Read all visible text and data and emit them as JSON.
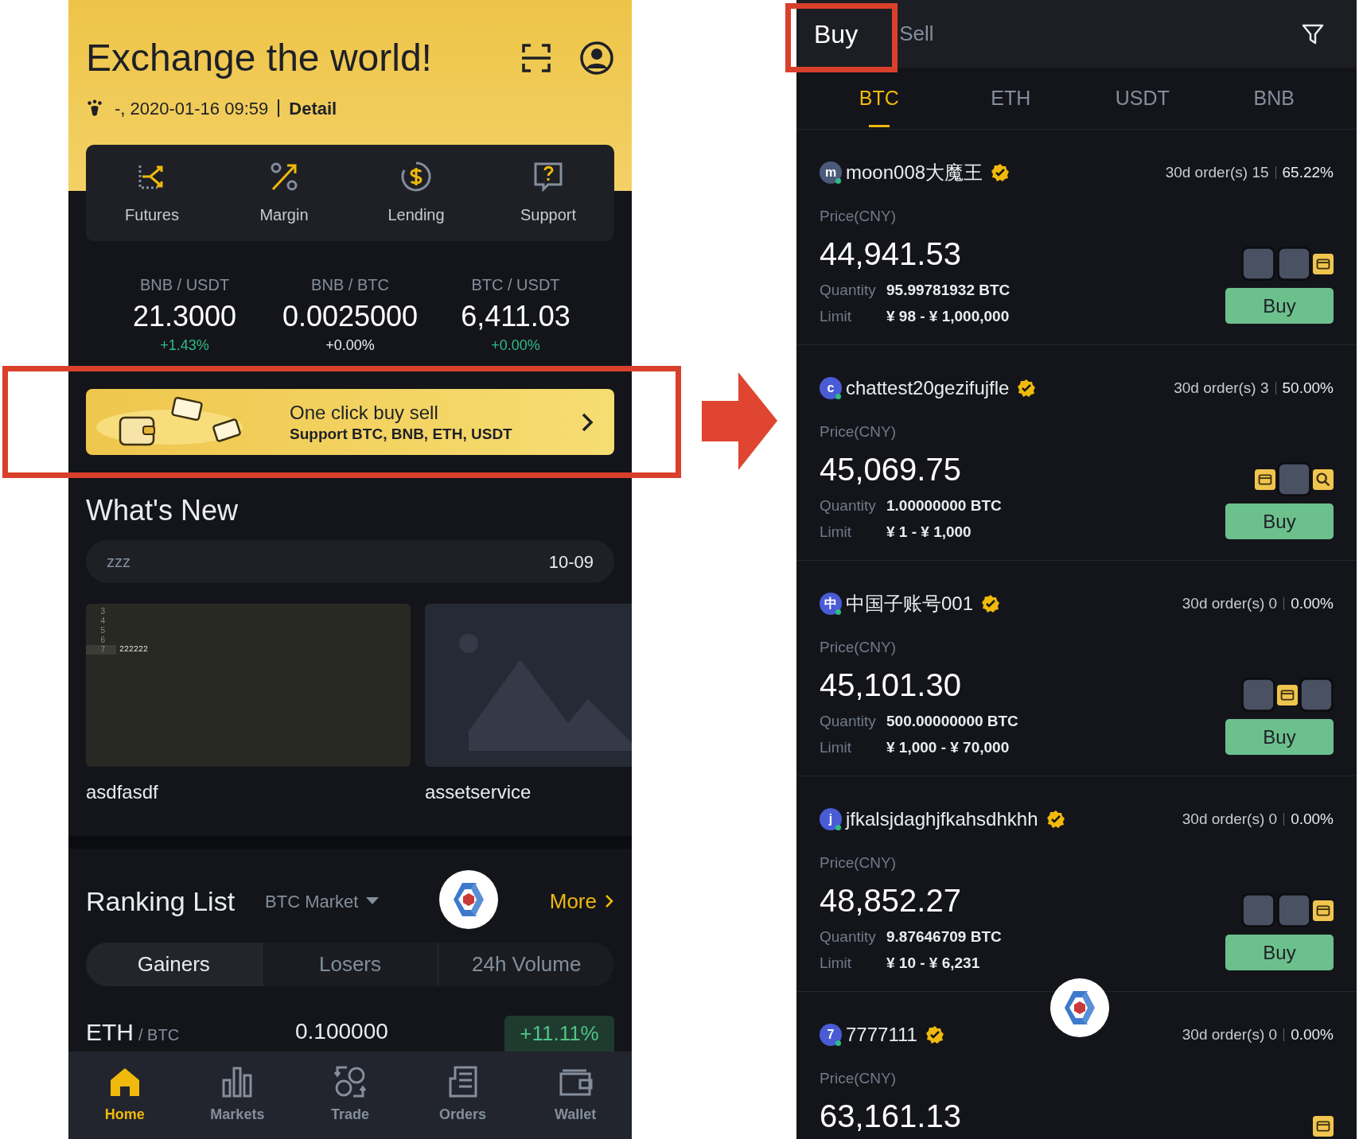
{
  "home_screen": {
    "header": {
      "title": "Exchange the world!",
      "login_info": "-, 2020-01-16 09:59",
      "detail_link": "Detail"
    },
    "quick_menu": [
      {
        "kind": "futures",
        "label": "Futures"
      },
      {
        "kind": "margin",
        "label": "Margin"
      },
      {
        "kind": "lending",
        "label": "Lending"
      },
      {
        "kind": "support",
        "label": "Support"
      }
    ],
    "tickers": [
      {
        "pair": "BNB / USDT",
        "price": "21.3000",
        "change": "+1.43%",
        "color": "#2ebd85"
      },
      {
        "pair": "BNB / BTC",
        "price": "0.0025000",
        "change": "+0.00%",
        "color": "#eaecef"
      },
      {
        "pair": "BTC / USDT",
        "price": "6,411.03",
        "change": "+0.00%",
        "color": "#2ebd85"
      }
    ],
    "promo_banner": {
      "title": "One click buy sell",
      "subtitle": "Support BTC, BNB, ETH, USDT"
    },
    "whats_new": {
      "title": "What's New",
      "notice": {
        "text": "zzz",
        "date": "10-09"
      },
      "cards": [
        {
          "kind": "editor",
          "line_numbers": [
            "3",
            "4",
            "5",
            "6",
            "7"
          ],
          "editor_text": "222222",
          "caption": "asdfasdf"
        },
        {
          "kind": "placeholder",
          "caption": "assetservice"
        }
      ]
    },
    "ranking": {
      "title": "Ranking List",
      "market": "BTC Market",
      "more": "More",
      "tabs": [
        {
          "label": "Gainers",
          "selected": true
        },
        {
          "label": "Losers",
          "selected": false
        },
        {
          "label": "24h Volume",
          "selected": false
        }
      ],
      "rows": [
        {
          "base": "ETH",
          "quote": "/ BTC",
          "price": "0.100000",
          "change": "+11.11%"
        }
      ]
    },
    "bottom_nav": [
      {
        "kind": "home",
        "label": "Home",
        "selected": true
      },
      {
        "kind": "markets",
        "label": "Markets",
        "selected": false
      },
      {
        "kind": "trade",
        "label": "Trade",
        "selected": false
      },
      {
        "kind": "orders",
        "label": "Orders",
        "selected": false
      },
      {
        "kind": "wallet",
        "label": "Wallet",
        "selected": false
      }
    ]
  },
  "p2p_screen": {
    "side_tabs": [
      {
        "label": "Buy",
        "selected": true
      },
      {
        "label": "Sell",
        "selected": false
      }
    ],
    "coin_tabs": [
      {
        "label": "BTC",
        "selected": true
      },
      {
        "label": "ETH",
        "selected": false
      },
      {
        "label": "USDT",
        "selected": false
      },
      {
        "label": "BNB",
        "selected": false
      }
    ],
    "listings": [
      {
        "avatar": "m",
        "color": "#4b5a7a",
        "online": true,
        "name": "moon008大魔王",
        "verified": true,
        "orders": "30d order(s) 15",
        "completion": "65.22%",
        "price_label": "Price(CNY)",
        "price": "44,941.53",
        "quantity_label": "Quantity",
        "quantity": "95.99781932 BTC",
        "limit_label": "Limit",
        "limit": "¥ 98 - ¥ 1,000,000",
        "payment_icons": [
          {
            "kind": "tile"
          },
          {
            "kind": "tile"
          },
          {
            "kind": "card"
          }
        ],
        "button": "Buy"
      },
      {
        "avatar": "c",
        "color": "#4a5bd6",
        "online": true,
        "name": "chattest20gezifujfle",
        "verified": true,
        "orders": "30d order(s) 3",
        "completion": "50.00%",
        "price_label": "Price(CNY)",
        "price": "45,069.75",
        "quantity_label": "Quantity",
        "quantity": "1.00000000 BTC",
        "limit_label": "Limit",
        "limit": "¥ 1 - ¥ 1,000",
        "payment_icons": [
          {
            "kind": "card"
          },
          {
            "kind": "tile"
          },
          {
            "kind": "search"
          }
        ],
        "button": "Buy"
      },
      {
        "avatar": "中",
        "color": "#4a5bd6",
        "online": true,
        "name": "中国子账号001",
        "verified": true,
        "orders": "30d order(s) 0",
        "completion": "0.00%",
        "price_label": "Price(CNY)",
        "price": "45,101.30",
        "quantity_label": "Quantity",
        "quantity": "500.00000000 BTC",
        "limit_label": "Limit",
        "limit": "¥ 1,000 - ¥ 70,000",
        "payment_icons": [
          {
            "kind": "tile"
          },
          {
            "kind": "card"
          },
          {
            "kind": "tile"
          }
        ],
        "button": "Buy"
      },
      {
        "avatar": "j",
        "color": "#4a5bd6",
        "online": true,
        "name": "jfkalsjdaghjfkahsdhkhh",
        "verified": true,
        "orders": "30d order(s) 0",
        "completion": "0.00%",
        "price_label": "Price(CNY)",
        "price": "48,852.27",
        "quantity_label": "Quantity",
        "quantity": "9.87646709 BTC",
        "limit_label": "Limit",
        "limit": "¥ 10 - ¥ 6,231",
        "payment_icons": [
          {
            "kind": "tile"
          },
          {
            "kind": "tile"
          },
          {
            "kind": "card"
          }
        ],
        "button": "Buy"
      },
      {
        "avatar": "7",
        "color": "#4a5bd6",
        "online": true,
        "name": "7777111",
        "verified": true,
        "orders": "30d order(s) 0",
        "completion": "0.00%",
        "price_label": "Price(CNY)",
        "price": "63,161.13",
        "payment_icons": [
          {
            "kind": "card"
          }
        ]
      }
    ]
  }
}
